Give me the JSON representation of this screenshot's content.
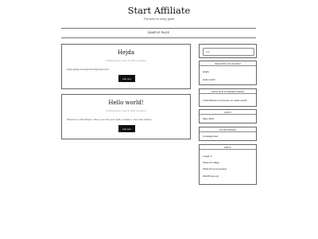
{
  "site": {
    "title": "Start Affiliate",
    "description": "The store for every guide"
  },
  "nav": {
    "items": [
      "SAMPLE PAGE"
    ]
  },
  "posts": [
    {
      "title": "Hejda",
      "meta": "Publicerat den mars 9, 2021 av admin",
      "excerpt": "bajlsngklagnvbnebjnlvrlhvdsgbnlvbmlvd",
      "read_more": "Läs mer"
    },
    {
      "title": "Hello world!",
      "meta": "Publicerat den mars 9, 2021 av admin",
      "excerpt": "Welcome to WordPress. This is your first post. Edit or delete it, then start writing!",
      "read_more": "Läs mer"
    }
  ],
  "sidebar": {
    "search": {
      "placeholder": "Sök …"
    },
    "recent_posts": {
      "heading": "SENASTE INLÄGGEN",
      "items": [
        "Hejda",
        "Hello world!"
      ]
    },
    "recent_comments": {
      "heading": "SENASTE KOMMENTARER",
      "items": [
        "A WordPress Commenter om Hello world!"
      ]
    },
    "archive": {
      "heading": "ARKIV",
      "items": [
        "Mars 2021"
      ]
    },
    "categories": {
      "heading": "KATEGORIER",
      "items": [
        "Uncategorized"
      ]
    },
    "meta": {
      "heading": "META",
      "items": [
        "Logga in",
        "Flöde för inlägg",
        "Flöde för kommentarer",
        "WordPress.org"
      ]
    }
  }
}
